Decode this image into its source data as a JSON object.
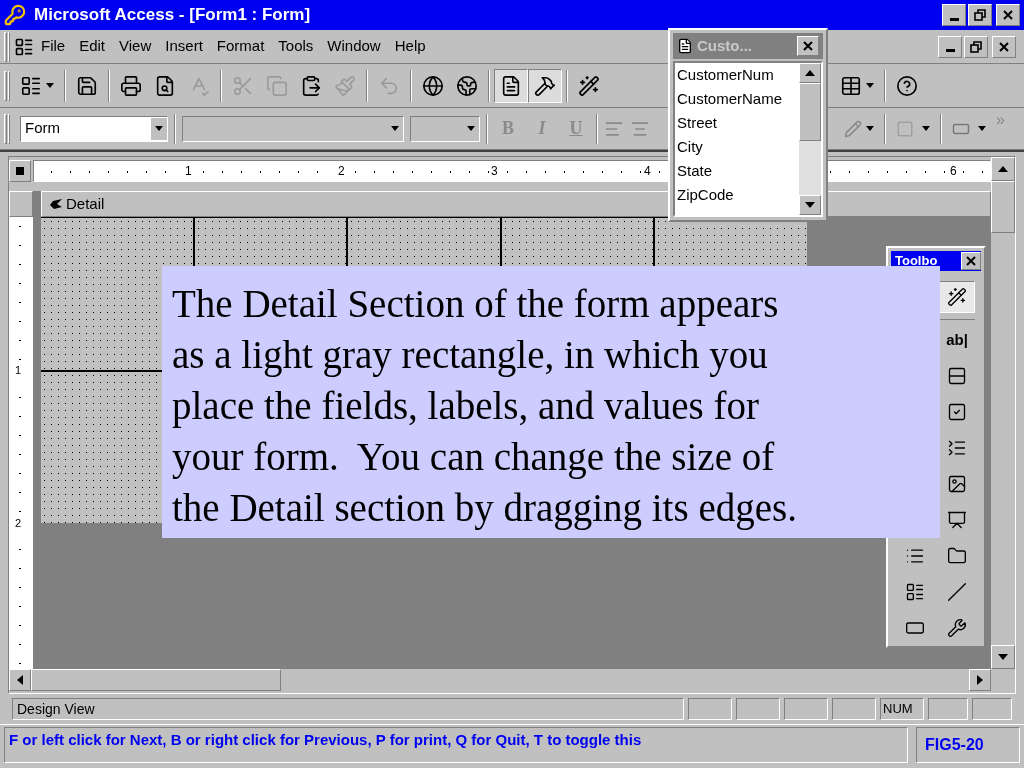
{
  "window": {
    "title": "Microsoft Access - [Form1 : Form]"
  },
  "menu": [
    "File",
    "Edit",
    "View",
    "Insert",
    "Format",
    "Tools",
    "Window",
    "Help"
  ],
  "standard_toolbar": [
    {
      "kind": "view",
      "on": false,
      "disabled": false
    },
    {
      "kind": "separator"
    },
    {
      "kind": "save",
      "on": false,
      "disabled": false
    },
    {
      "kind": "separator"
    },
    {
      "kind": "print",
      "on": false,
      "disabled": false
    },
    {
      "kind": "preview",
      "on": false,
      "disabled": false
    },
    {
      "kind": "spelling",
      "on": false,
      "disabled": true
    },
    {
      "kind": "separator"
    },
    {
      "kind": "cut",
      "on": false,
      "disabled": true
    },
    {
      "kind": "copy",
      "on": false,
      "disabled": true
    },
    {
      "kind": "paste",
      "on": false,
      "disabled": false
    },
    {
      "kind": "format_painter",
      "on": false,
      "disabled": true
    },
    {
      "kind": "separator"
    },
    {
      "kind": "undo",
      "on": false,
      "disabled": true
    },
    {
      "kind": "separator"
    },
    {
      "kind": "web",
      "on": false,
      "disabled": false
    },
    {
      "kind": "hyperlink",
      "on": false,
      "disabled": false
    },
    {
      "kind": "separator"
    },
    {
      "kind": "properties",
      "on": true,
      "disabled": false
    },
    {
      "kind": "toolbox",
      "on": true,
      "disabled": false
    },
    {
      "kind": "separator"
    },
    {
      "kind": "build",
      "on": false,
      "disabled": false
    }
  ],
  "standard_toolbar_right": [
    {
      "kind": "new_object"
    },
    {
      "kind": "separator"
    },
    {
      "kind": "help"
    }
  ],
  "formatting_toolbar": {
    "object": "Form",
    "bold": "B",
    "italic": "I",
    "underline": "U",
    "chevron": "»"
  },
  "ruler": {
    "marks": [
      "1",
      "2",
      "3",
      "4",
      "6"
    ],
    "vertical_marks": [
      "1",
      "2"
    ]
  },
  "section": {
    "title": "Detail"
  },
  "field_list": {
    "title": "Custo...",
    "fields": [
      "CustomerNum",
      "CustomerName",
      "Street",
      "City",
      "State",
      "ZipCode"
    ]
  },
  "toolbox": {
    "title": "Toolbo",
    "rows": [
      {
        "right": {
          "kind": "wand",
          "on": true
        }
      },
      {
        "right": {
          "kind": "text_box",
          "label": "ab|",
          "on": false
        }
      },
      {
        "right": {
          "kind": "option_group",
          "on": false
        }
      },
      {
        "right": {
          "kind": "check_box",
          "on": false
        }
      },
      {
        "right": {
          "kind": "combo",
          "on": false
        }
      },
      {
        "right": {
          "kind": "image",
          "on": false
        }
      },
      {
        "right": {
          "kind": "object_frame",
          "on": false
        }
      },
      {
        "left": {
          "kind": "list",
          "on": false
        },
        "right": {
          "kind": "tab",
          "on": false
        }
      },
      {
        "left": {
          "kind": "subform",
          "on": false
        },
        "right": {
          "kind": "line",
          "on": false
        }
      },
      {
        "left": {
          "kind": "rectangle",
          "on": false
        },
        "right": {
          "kind": "more_tools",
          "on": false
        }
      }
    ]
  },
  "callout": {
    "text": "The Detail Section of the form appears\nas a light gray rectangle, in which you\nplace the fields, labels, and values for\nyour form.  You can change the size of\nthe Detail section by dragging its edges."
  },
  "status_bar": {
    "text": "Design View",
    "indicator": "NUM"
  },
  "footer": {
    "instructions": "F or left click for Next, B or right click for Previous, P for print, Q for Quit, T to toggle this",
    "figure": "FIG5-20"
  }
}
